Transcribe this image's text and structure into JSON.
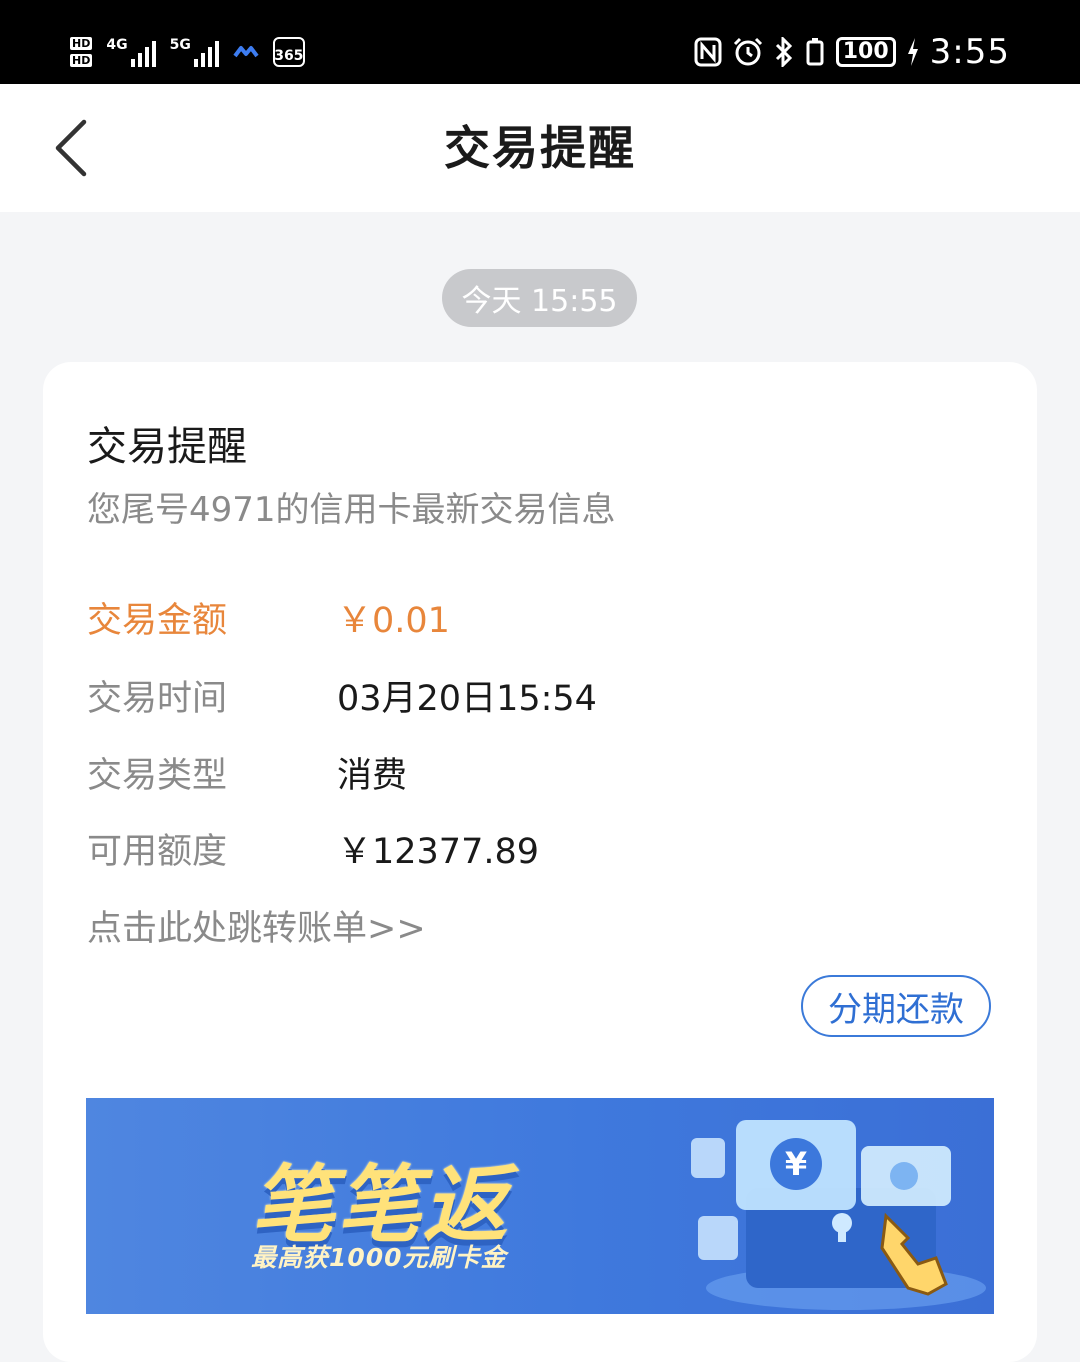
{
  "status_bar": {
    "hd1": "HD",
    "hd2": "HD",
    "net1": "4G",
    "net2": "5G",
    "app_badge": "365",
    "nfc": "N",
    "battery": "100",
    "time": "3:55"
  },
  "nav": {
    "title": "交易提醒"
  },
  "message": {
    "timestamp": "今天 15:55",
    "title": "交易提醒",
    "subtitle": "您尾号4971的信用卡最新交易信息",
    "rows": [
      {
        "label": "交易金额",
        "value": "￥0.01"
      },
      {
        "label": "交易时间",
        "value": "03月20日15:54"
      },
      {
        "label": "交易类型",
        "value": "消费"
      },
      {
        "label": "可用额度",
        "value": "￥12377.89"
      }
    ],
    "bill_link": "点击此处跳转账单>>",
    "installment_button": "分期还款"
  },
  "banner": {
    "title": "笔笔返",
    "subtitle": "最高获1000元刷卡金",
    "coin_symbol": "¥"
  },
  "colors": {
    "accent_orange": "#e8863b",
    "accent_blue": "#2f6fd3",
    "banner_blue": "#4f86e0"
  }
}
